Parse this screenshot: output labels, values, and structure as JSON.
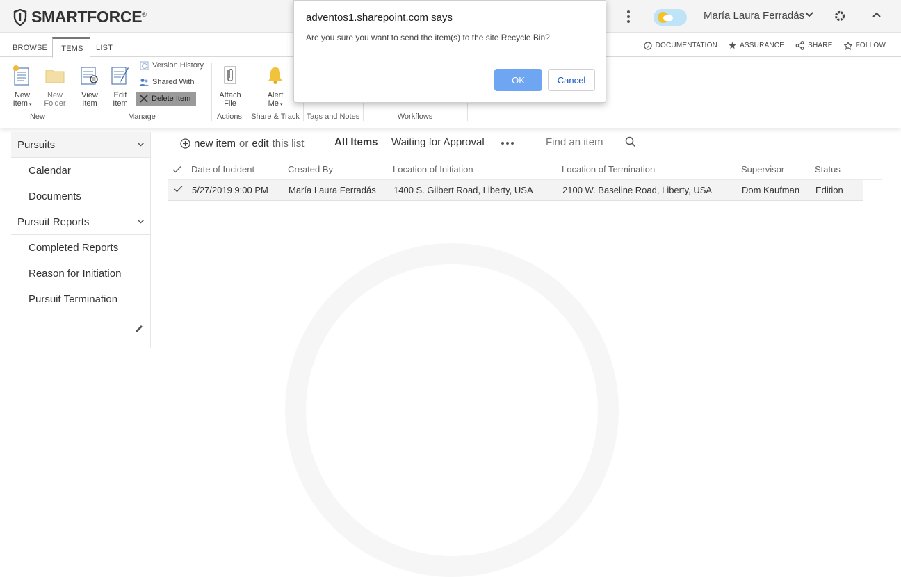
{
  "brand": {
    "name": "SMARTFORCE",
    "trademark": "®"
  },
  "header": {
    "user_name": "María Laura Ferradás"
  },
  "ribbon": {
    "tabs": [
      "BROWSE",
      "ITEMS",
      "LIST"
    ],
    "top_actions": [
      "DOCUMENTATION",
      "ASSURANCE",
      "SHARE",
      "FOLLOW"
    ],
    "groups": {
      "new": {
        "label": "New",
        "new_item": [
          "New",
          "Item"
        ],
        "new_folder": [
          "New",
          "Folder"
        ]
      },
      "manage": {
        "label": "Manage",
        "view_item": [
          "View",
          "Item"
        ],
        "edit_item": [
          "Edit",
          "Item"
        ],
        "version_history": "Version History",
        "shared_with": "Shared With",
        "delete_item": "Delete Item"
      },
      "actions": {
        "label": "Actions",
        "attach_file": [
          "Attach",
          "File"
        ]
      },
      "share_track": {
        "label": "Share & Track",
        "alert_me": [
          "Alert",
          "Me"
        ]
      },
      "tags_notes": {
        "label": "Tags and Notes"
      },
      "workflows": {
        "label": "Workflows"
      }
    }
  },
  "sidebar": {
    "items": [
      {
        "label": "Pursuits",
        "type": "head"
      },
      {
        "label": "Calendar",
        "type": "sub"
      },
      {
        "label": "Documents",
        "type": "sub"
      },
      {
        "label": "Pursuit Reports",
        "type": "head2"
      },
      {
        "label": "Completed Reports",
        "type": "sub"
      },
      {
        "label": "Reason for Initiation",
        "type": "sub"
      },
      {
        "label": "Pursuit Termination",
        "type": "sub"
      }
    ]
  },
  "list": {
    "new_item": "new item",
    "or": "or",
    "edit": "edit",
    "this_list": "this list",
    "views": [
      "All Items",
      "Waiting for Approval"
    ],
    "find_placeholder": "Find an item",
    "columns": [
      "Date of Incident",
      "Created By",
      "Location of Initiation",
      "Location of Termination",
      "Supervisor",
      "Status"
    ],
    "rows": [
      {
        "date": "5/27/2019 9:00 PM",
        "created_by": "María Laura Ferradás",
        "initiation": "1400 S. Gilbert Road, Liberty, USA",
        "termination": "2100 W. Baseline Road, Liberty, USA",
        "supervisor": "Dom Kaufman",
        "status": "Edition"
      }
    ]
  },
  "dialog": {
    "title": "adventos1.sharepoint.com says",
    "message": "Are you sure you want to send the item(s) to the site Recycle Bin?",
    "ok_label": "OK",
    "cancel_label": "Cancel"
  }
}
